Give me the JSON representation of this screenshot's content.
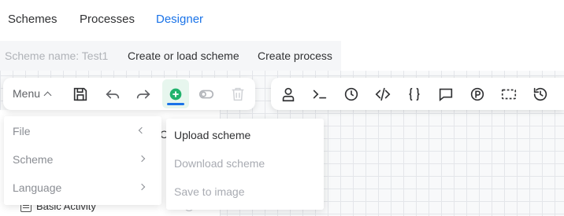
{
  "nav": {
    "tabs": [
      "Schemes",
      "Processes",
      "Designer"
    ],
    "active": "Designer"
  },
  "scheme_bar": {
    "scheme_name_placeholder": "Scheme name: Test1",
    "create_or_load": "Create or load scheme",
    "create_process": "Create process"
  },
  "toolbar": {
    "menu_label": "Menu",
    "left_icons": [
      "save-icon",
      "undo-icon",
      "redo-icon",
      "add-icon",
      "toggle-icon",
      "trash-icon"
    ],
    "right_icons": [
      "person-icon",
      "terminal-icon",
      "clock-icon",
      "code-icon",
      "braces-icon",
      "comment-icon",
      "parameter-icon",
      "selection-icon",
      "history-icon"
    ]
  },
  "menu": {
    "items": [
      {
        "label": "File"
      },
      {
        "label": "Scheme"
      },
      {
        "label": "Language"
      }
    ]
  },
  "file_submenu": {
    "items": [
      {
        "label": "Upload scheme",
        "enabled": true
      },
      {
        "label": "Download scheme",
        "enabled": false
      },
      {
        "label": "Save to image",
        "enabled": false
      }
    ]
  },
  "sidebar": {
    "peek_text": "C",
    "activity": "Basic Activity"
  },
  "colors": {
    "accent": "#1a73e8",
    "add_green": "#20b26c",
    "muted": "#8a8d93"
  }
}
